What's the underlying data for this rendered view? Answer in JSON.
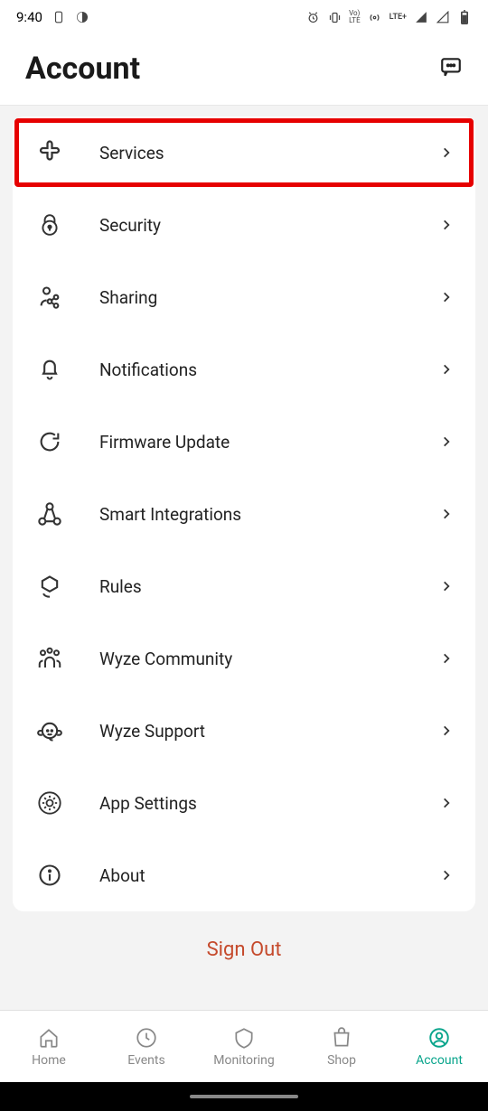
{
  "status": {
    "time": "9:40",
    "lte": "LTE+"
  },
  "header": {
    "title": "Account"
  },
  "menu": {
    "items": [
      {
        "label": "Services"
      },
      {
        "label": "Security"
      },
      {
        "label": "Sharing"
      },
      {
        "label": "Notifications"
      },
      {
        "label": "Firmware Update"
      },
      {
        "label": "Smart Integrations"
      },
      {
        "label": "Rules"
      },
      {
        "label": "Wyze Community"
      },
      {
        "label": "Wyze Support"
      },
      {
        "label": "App Settings"
      },
      {
        "label": "About"
      }
    ]
  },
  "sign_out": "Sign Out",
  "tabs": {
    "home": "Home",
    "events": "Events",
    "monitoring": "Monitoring",
    "shop": "Shop",
    "account": "Account"
  }
}
